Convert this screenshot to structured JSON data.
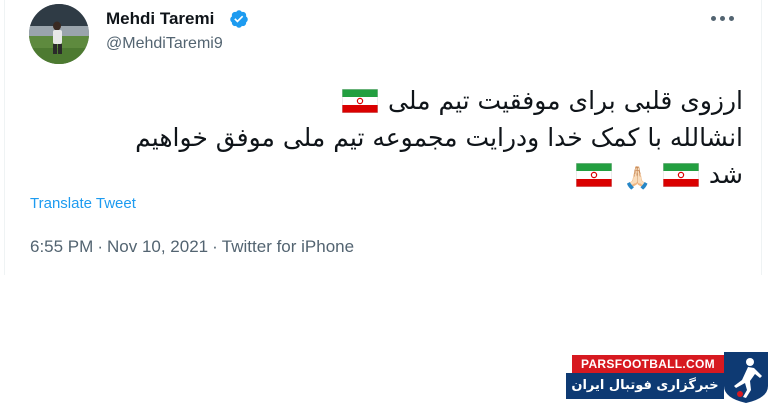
{
  "user": {
    "name": "Mehdi Taremi",
    "handle": "@MehdiTaremi9",
    "verified_icon": "verified-badge-icon"
  },
  "tweet": {
    "line1": "ارزوی قلبی برای موفقیت تیم ملی",
    "line2": "انشالله با کمک خدا ودرایت مجموعه تیم ملی موفق خواهیم",
    "line3": "شد",
    "emoji": {
      "flag": "flag-iran-icon",
      "hands": "🙏🏻"
    }
  },
  "translate_label": "Translate Tweet",
  "meta": {
    "time": "6:55 PM",
    "separator": "·",
    "date": "Nov 10, 2021",
    "source": "Twitter for iPhone"
  },
  "watermark": {
    "top": "PARSFOOTBALL.COM",
    "bottom": "خبرگزاری فوتبال ایران"
  },
  "colors": {
    "accent": "#1d9bf0",
    "secondary_text": "#536471",
    "primary_text": "#0f1419",
    "brand_red": "#d71920",
    "brand_blue": "#0e3a73"
  }
}
